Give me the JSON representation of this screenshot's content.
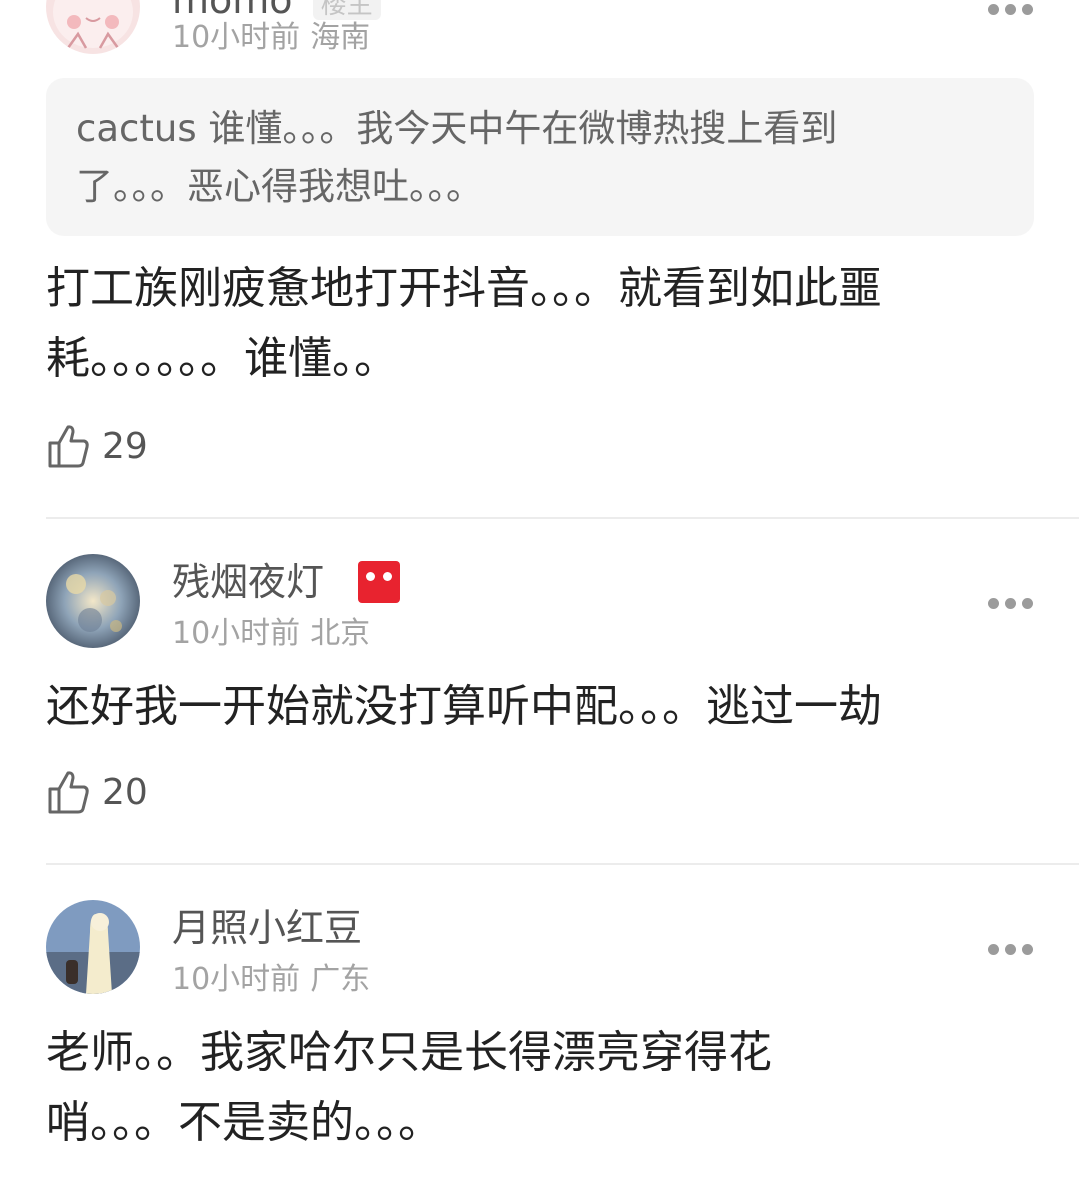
{
  "comments": [
    {
      "username": "momo",
      "tag": "楼主",
      "time": "10小时前",
      "location": "海南",
      "quote": "cactus 谁懂。。。我今天中午在微博热搜上看到了。。。恶心得我想吐。。。",
      "text": "打工族刚疲惫地打开抖音。。。就看到如此噩耗。。。。。。谁懂。。",
      "likes": "29"
    },
    {
      "username": "残烟夜灯",
      "time": "10小时前",
      "location": "北京",
      "text": "还好我一开始就没打算听中配。。。逃过一劫",
      "likes": "20"
    },
    {
      "username": "月照小红豆",
      "time": "10小时前",
      "location": "广东",
      "text": "老师。。我家哈尔只是长得漂亮穿得花哨。。。不是卖的。。。"
    }
  ],
  "icons": {
    "more": "more-dots-icon",
    "like": "thumbs-up-icon",
    "badge": "red-face-badge-icon"
  },
  "colors": {
    "badge": "#e8232f",
    "quote_bg": "#f5f5f5"
  }
}
